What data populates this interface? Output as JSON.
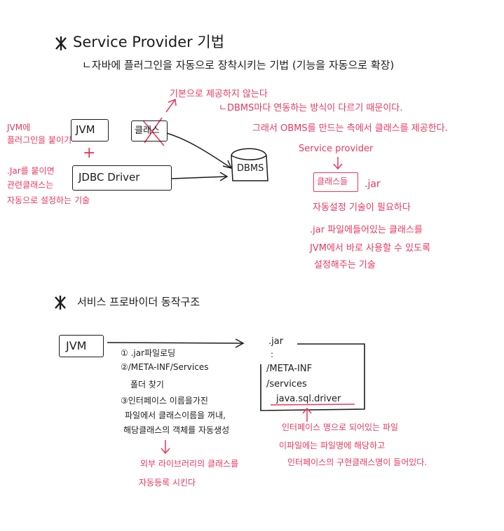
{
  "colors": {
    "ink": "#1c1c1c",
    "accent": "#e8395e"
  },
  "section1": {
    "title": "Service  Provider 기법",
    "subtitle": "ㄴ자바에  플러그인을  자동으로 장착시키는 기법  (기능을 자동으로 확장)",
    "jvm": "JVM",
    "jdbc": "JDBC Driver",
    "class_box": "클래스",
    "dbms": "DBMS",
    "left_note": [
      "JVM에",
      "플러그인을 붙이기"
    ],
    "plus": "+",
    "jar_note": [
      ".Jar를 붙이면",
      "관련클래스는",
      "자동으로  설정하는 기술"
    ],
    "top_note": "기본으로 제공하지  않는다",
    "reason_note": "ㄴDBMS마다 연동하는 방식이  다르기 때문이다.",
    "provide_note": "그래서 OBMS를  만드는 측에서  클래스를 제공한다.",
    "service_provider": "Service  provider",
    "classes_box": "클래스들",
    "jar": ".jar",
    "auto_setting": "자동설정  기술이 필요하다",
    "jar_desc": [
      ".jar  파일에들어있는 클래스를",
      "JVM에서 바로 사용할  수 있도록",
      "설정해주는 기술"
    ]
  },
  "section2": {
    "title": "서비스  프로바이더   동작구조",
    "jvm": "JVM",
    "steps": [
      "① .jar파일로딩",
      "②/META-INF/Services",
      "   폴더 찾기",
      "③인터페이스  이름을가진",
      "파일에서 클래스이름을 꺼내,",
      "해당클래스의 객체를  자동생성"
    ],
    "jar_lines": [
      ".jar",
      ":",
      "/META-INF",
      "/services"
    ],
    "driver_file": "java.sql.driver",
    "file_note": [
      "인터페이스 명으로 되어있는 파일",
      "이파일에는  파일명에  해당하고",
      "인터페이스의  구현클래스명이 들어있다."
    ],
    "lib_note": [
      "외부  라이브러리의 클래스를",
      "자동등록 시킨다"
    ]
  }
}
